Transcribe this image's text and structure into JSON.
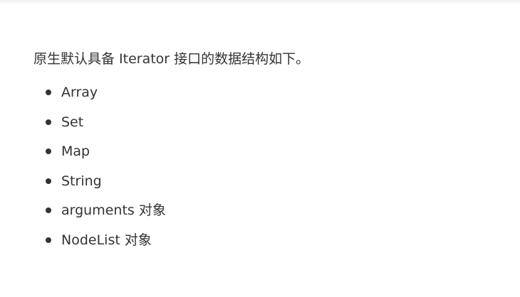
{
  "intro": "原生默认具备 Iterator 接口的数据结构如下。",
  "items": [
    {
      "label": "Array"
    },
    {
      "label": "Set"
    },
    {
      "label": "Map"
    },
    {
      "label": "String"
    },
    {
      "label": "arguments 对象"
    },
    {
      "label": "NodeList 对象"
    }
  ]
}
